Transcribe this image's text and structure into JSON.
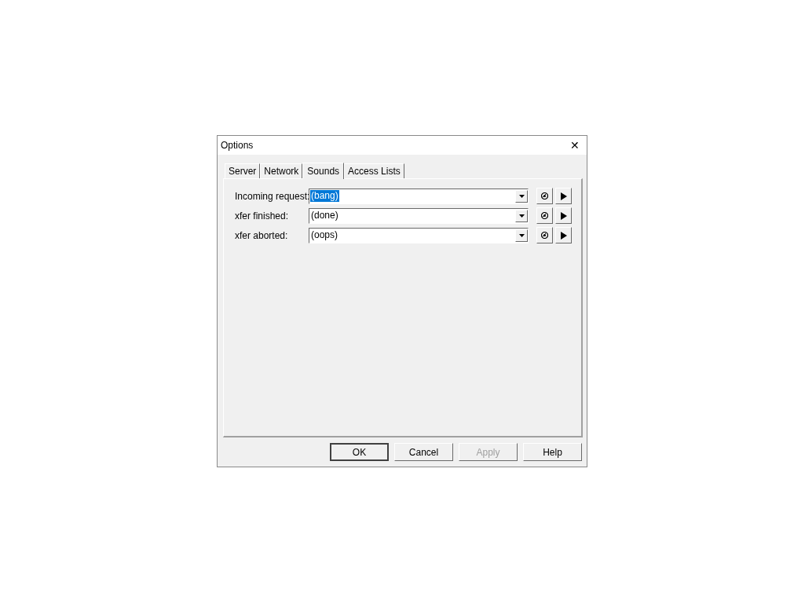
{
  "window": {
    "title": "Options",
    "close": "✕"
  },
  "tabs": [
    {
      "label": "Server",
      "selected": false
    },
    {
      "label": "Network",
      "selected": false
    },
    {
      "label": "Sounds",
      "selected": true
    },
    {
      "label": "Access Lists",
      "selected": false
    }
  ],
  "sounds": [
    {
      "label": "Incoming request:",
      "value": "(bang)",
      "text_selected": true
    },
    {
      "label": "xfer finished:",
      "value": "(done)",
      "text_selected": false
    },
    {
      "label": "xfer aborted:",
      "value": "(oops)",
      "text_selected": false
    }
  ],
  "buttons": [
    {
      "label": "OK",
      "default": true,
      "disabled": false
    },
    {
      "label": "Cancel",
      "default": false,
      "disabled": false
    },
    {
      "label": "Apply",
      "default": false,
      "disabled": true
    },
    {
      "label": "Help",
      "default": false,
      "disabled": false
    }
  ]
}
